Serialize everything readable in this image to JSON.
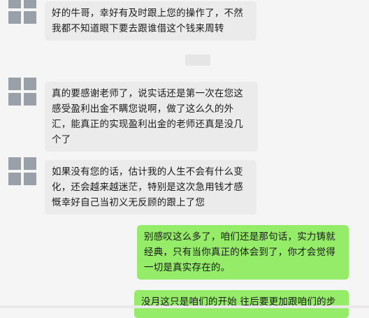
{
  "messages": [
    {
      "sender": "contact",
      "text": "好的牛哥，幸好有及时跟上您的操作了，不然我都不知道眼下要去跟谁借这个钱来周转"
    },
    {
      "sender": "contact",
      "text": "真的要感谢老师了，说实话还是第一次在您这感受盈利出金不瞒您说啊，做了这么久的外汇，能真正的实现盈利出金的老师还真是没几个了"
    },
    {
      "sender": "contact",
      "text": "如果没有您的话，估计我的人生不会有什么变化，还会越来越迷茫，特别是这次急用钱才感慨幸好自己当初义无反顾的跟上了您"
    },
    {
      "sender": "me",
      "text": "别感叹这么多了，咱们还是那句话，实力铸就经典，只有当你真正的体会到了，你才会觉得一切是真实存在的。"
    },
    {
      "sender": "me",
      "text": "没月这只是咱们的开始 往后要更加跟咱们的步"
    }
  ],
  "colors": {
    "incoming": "#ebebeb",
    "outgoing": "#95ec69",
    "background": "#f5f5f5",
    "avatar": "#9aa0a8"
  }
}
